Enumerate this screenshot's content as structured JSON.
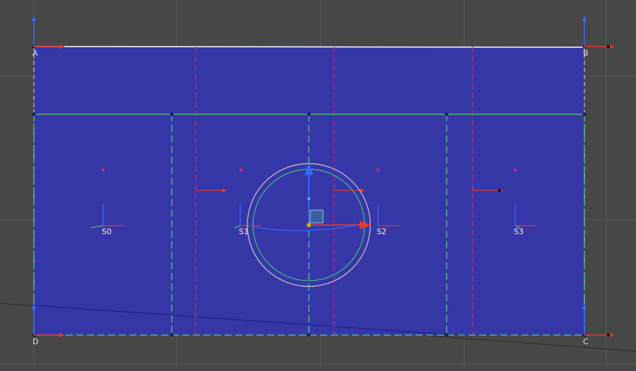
{
  "scene": {
    "colors": {
      "background": "#474747",
      "grid": "#5a5a5a",
      "panel_fill": "#3636a8",
      "panel_edge": "#ffffff",
      "section_line": "#3ec07a",
      "guide_line": "#c0306a",
      "x_axis": "#e33a2a",
      "y_axis": "#2f6cff",
      "gizmo_ring": "#c8c8c8",
      "gizmo_inner_ring": "#3ec07a"
    },
    "corners": {
      "a": "A",
      "b": "B",
      "c": "C",
      "d": "D"
    },
    "sections": [
      {
        "label": "S0"
      },
      {
        "label": "S1"
      },
      {
        "label": "S2"
      },
      {
        "label": "S3"
      }
    ]
  }
}
